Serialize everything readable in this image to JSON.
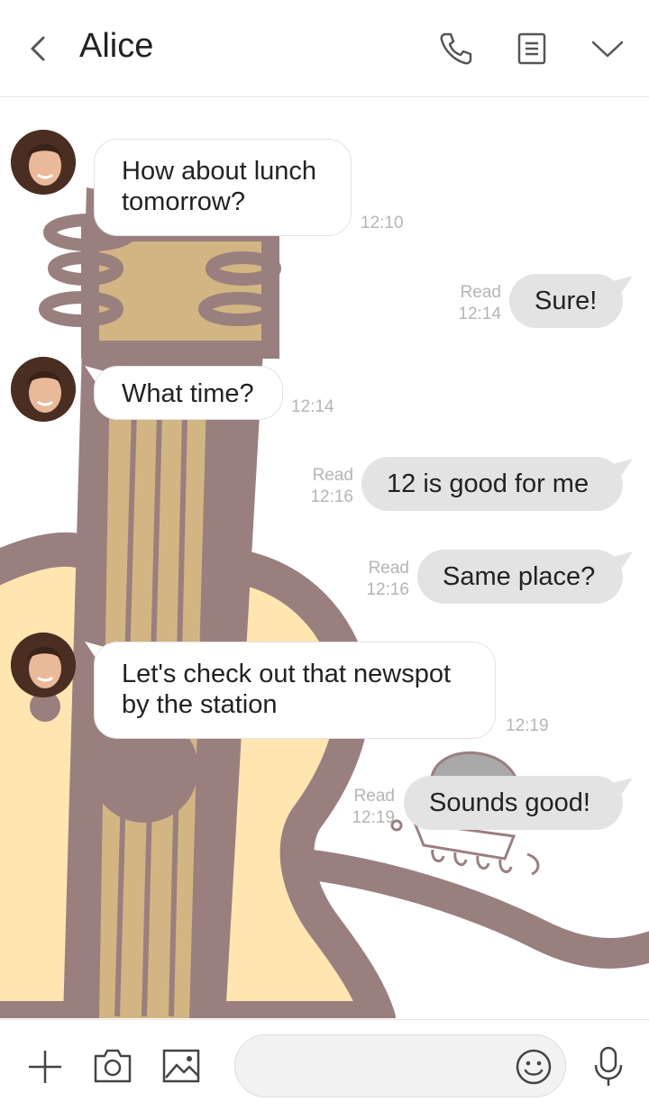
{
  "header": {
    "title": "Alice",
    "back_icon": "chevron-left-icon",
    "call_icon": "phone-icon",
    "notes_icon": "notes-icon",
    "menu_icon": "chevron-down-icon"
  },
  "messages": [
    {
      "side": "in",
      "text": "How about lunch\ntomorrow?",
      "time": "12:10"
    },
    {
      "side": "out",
      "text": "Sure!",
      "read": "Read",
      "time": "12:14"
    },
    {
      "side": "in",
      "text": "What time?",
      "time": "12:14"
    },
    {
      "side": "out",
      "text": "12 is good for me",
      "read": "Read",
      "time": "12:16"
    },
    {
      "side": "out",
      "text": "Same place?",
      "read": "Read",
      "time": "12:16"
    },
    {
      "side": "in",
      "text": "Let's check out that newspot\nby the station",
      "time": "12:19"
    },
    {
      "side": "out",
      "text": "Sounds good!",
      "read": "Read",
      "time": "12:19"
    }
  ],
  "footer": {
    "add_icon": "plus-icon",
    "camera_icon": "camera-icon",
    "gallery_icon": "image-icon",
    "message_placeholder": "",
    "emoji_icon": "smiley-icon",
    "mic_icon": "microphone-icon"
  },
  "colors": {
    "incoming_bubble": "#ffffff",
    "outgoing_bubble": "#e3e3e3",
    "timestamp": "#b5b5b5",
    "background_guitar_outline": "#9a7f7f",
    "background_guitar_body": "#ffe6b0",
    "background_guitar_neck": "#d2b582"
  }
}
